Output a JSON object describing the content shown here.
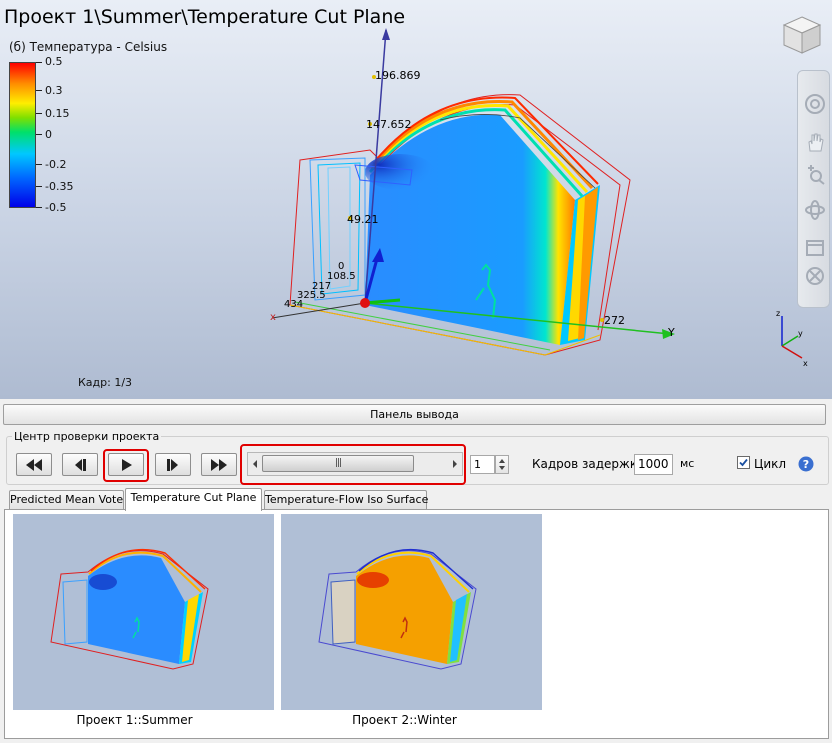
{
  "viewport": {
    "title": "Проект 1\\Summer\\Temperature Cut Plane",
    "legend": {
      "title": "(б) Температура - Celsius",
      "ticks": [
        "0.5",
        "0.3",
        "0.15",
        "0",
        "-0.2",
        "-0.35",
        "-0.5"
      ]
    },
    "axis_labels": {
      "z1": "196.869",
      "z2": "147.652",
      "z3": "49.21",
      "z0": "0",
      "x1": "108.5",
      "x2": "217",
      "x3": "325.5",
      "x4": "434",
      "y1": "272",
      "y_axis": "Y"
    },
    "frame": "Кадр: 1/3",
    "icons": [
      "nav-cube-icon",
      "steering-wheel-icon",
      "pan-hand-icon",
      "zoom-icon",
      "orbit-icon",
      "section-icon",
      "settings-icon",
      "mini-axes-icon"
    ]
  },
  "output_panel": {
    "label": "Панель вывода"
  },
  "control": {
    "group_title": "Центр проверки проекта",
    "buttons": [
      "first-frame",
      "previous-frame",
      "play",
      "next-frame",
      "last-frame"
    ],
    "slider_grip": "|||",
    "frame_value": "1",
    "delay_label": "Кадров задержки:",
    "delay_value": "1000",
    "delay_unit": "мс",
    "loop_label": "Цикл",
    "loop_checked": true
  },
  "tabs": [
    {
      "label": "Predicted Mean Vote",
      "active": false
    },
    {
      "label": "Temperature Cut Plane",
      "active": true
    },
    {
      "label": "Temperature-Flow Iso Surface",
      "active": false
    }
  ],
  "thumbnails": [
    {
      "caption": "Проект 1::Summer"
    },
    {
      "caption": "Проект 2::Winter"
    }
  ],
  "colors": {
    "highlight": "#e00000",
    "cold": "#1e8cff",
    "warm": "#f5a000",
    "viewport_bg": "#c9d3e4"
  }
}
